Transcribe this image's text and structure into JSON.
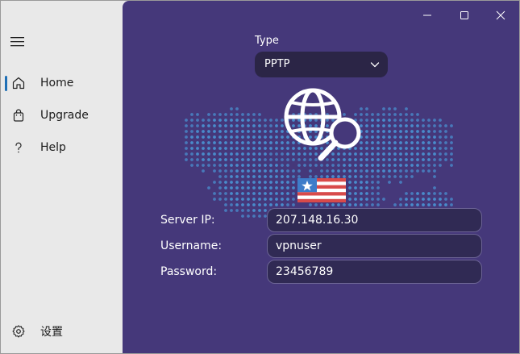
{
  "sidebar": {
    "items": [
      {
        "label": "Home",
        "icon": "home-icon",
        "active": true
      },
      {
        "label": "Upgrade",
        "icon": "shopping-bag-icon",
        "active": false
      },
      {
        "label": "Help",
        "icon": "question-icon",
        "active": false
      }
    ],
    "settings_label": "设置"
  },
  "connection": {
    "type_label": "Type",
    "type_value": "PPTP",
    "server_ip_label": "Server IP:",
    "server_ip": "207.148.16.30",
    "username_label": "Username:",
    "username": "vpnuser",
    "password_label": "Password:",
    "password": "23456789"
  },
  "colors": {
    "main_bg": "#45387a",
    "sidebar_bg": "#e9e9e9",
    "accent": "#1f6fb5",
    "map_dots": "#4a8fd0"
  }
}
